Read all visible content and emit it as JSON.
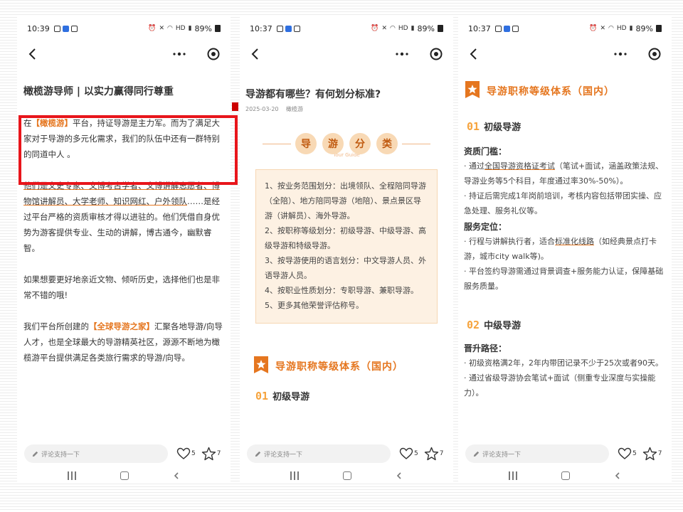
{
  "status_bars": [
    {
      "time": "10:39",
      "battery": "89%"
    },
    {
      "time": "10:37",
      "battery": "89%"
    },
    {
      "time": "10:37",
      "battery": "89%"
    }
  ],
  "network_label": "HD",
  "phone1": {
    "title": "橄榄游导师 | 以实力赢得同行尊重",
    "p1_before": "在",
    "p1_brand": "【橄榄游】",
    "p1_after": "平台，持证导游是主力军。而为了满足大家对于导游的多元化需求，我们的队伍中还有一群特别的同道中人 。",
    "p2_underlined": "他们是文史专家、文博考古学者、文博讲解志愿者、博物馆讲解员、大学老师、知识网红、户外领队",
    "p2_rest": "……是经过平台严格的资质审核才得以进驻的。他们凭借自身优势为游客提供专业、生动的讲解，博古通今，幽默睿智。",
    "p3": "如果想要更好地亲近文物、倾听历史，选择他们也是非常不错的哦!",
    "p4_before": "我们平台所创建的",
    "p4_brand": "【全球导游之家】",
    "p4_after": "汇聚各地导游/向导人才，也是全球最大的导游精英社区，源源不断地为橄榄游平台提供满足各类旅行需求的导游/向导。"
  },
  "phone2": {
    "title": "导游都有哪些？有何划分标准?",
    "date": "2025-03-20",
    "author": "橄榄游",
    "banner_chars": [
      "导",
      "游",
      "分",
      "类"
    ],
    "banner_sub": "Tour Guide",
    "items": [
      "1、按业务范围划分：出境领队、全程陪同导游（全陪）、地方陪同导游（地陪）、景点景区导游（讲解员）、海外导游。",
      "2、按职称等级划分：初级导游、中级导游、高级导游和特级导游。",
      "3、按导游使用的语言划分：中文导游人员、外语导游人员。",
      "4、按职业性质划分：专职导游、兼职导游。",
      "5、更多其他荣誉评估称号。"
    ],
    "section_title": "导游职称等级体系（国内）",
    "level1_num": "01",
    "level1_title": "初级导游"
  },
  "phone3": {
    "section_title": "导游职称等级体系（国内）",
    "level1_num": "01",
    "level1_title": "初级导游",
    "qual_heading": "资质门槛：",
    "qual_b1_before": "· 通过",
    "qual_b1_link": "全国导游资格证考试",
    "qual_b1_after": "（笔试+面试，涵盖政策法规、导游业务等5个科目，年度通过率30%-50%）。",
    "qual_b2": "· 持证后需完成1年岗前培训，考核内容包括带团实操、应急处理、服务礼仪等。",
    "pos_heading": "服务定位：",
    "pos_b1_before": "· 行程与讲解执行者，适合",
    "pos_b1_link": "标准化线路",
    "pos_b1_after": "（如经典景点打卡游，城市city walk等)。",
    "pos_b2": "· 平台签约导游需通过背景调查+服务能力认证，保障基础服务质量。",
    "level2_num": "02",
    "level2_title": "中级导游",
    "promo_heading": "晋升路径：",
    "promo_b1": "· 初级资格满2年，2年内带团记录不少于25次或者90天。",
    "promo_b2": "· 通过省级导游协会笔试+面试（侧重专业深度与实操能力）。"
  },
  "bottom": {
    "comment_placeholder": "评论支持一下",
    "likes": "5",
    "stars": "7"
  },
  "colors": {
    "accent": "#e5761f",
    "highlight": "#e8151b",
    "level_badge": "#f6a33c"
  }
}
